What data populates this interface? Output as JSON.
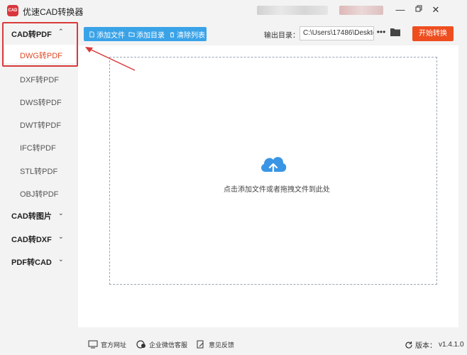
{
  "window": {
    "title": "优速CAD转换器",
    "logo_text": "CAD"
  },
  "sidebar": {
    "groups": [
      {
        "label": "CAD转PDF",
        "expanded": true,
        "items": [
          {
            "label": "DWG转PDF",
            "active": true
          },
          {
            "label": "DXF转PDF"
          },
          {
            "label": "DWS转PDF"
          },
          {
            "label": "DWT转PDF"
          },
          {
            "label": "IFC转PDF"
          },
          {
            "label": "STL转PDF"
          },
          {
            "label": "OBJ转PDF"
          }
        ]
      },
      {
        "label": "CAD转图片",
        "expanded": false
      },
      {
        "label": "CAD转DXF",
        "expanded": false
      },
      {
        "label": "PDF转CAD",
        "expanded": false
      }
    ]
  },
  "toolbar": {
    "add_file": "添加文件",
    "add_folder": "添加目录",
    "clear_list": "清除列表",
    "output_label": "输出目录：",
    "output_path": "C:\\Users\\17486\\Deskto",
    "more": "•••",
    "start": "开始转换"
  },
  "dropzone": {
    "hint": "点击添加文件或者拖拽文件到此处"
  },
  "footer": {
    "website": "官方网址",
    "wechat": "企业微信客服",
    "feedback": "意见反馈",
    "version_label": "版本：",
    "version": "v1.4.1.0"
  },
  "colors": {
    "accent_blue": "#3aa3e8",
    "accent_orange": "#ee4e1f",
    "highlight_red": "#d93a3a"
  }
}
